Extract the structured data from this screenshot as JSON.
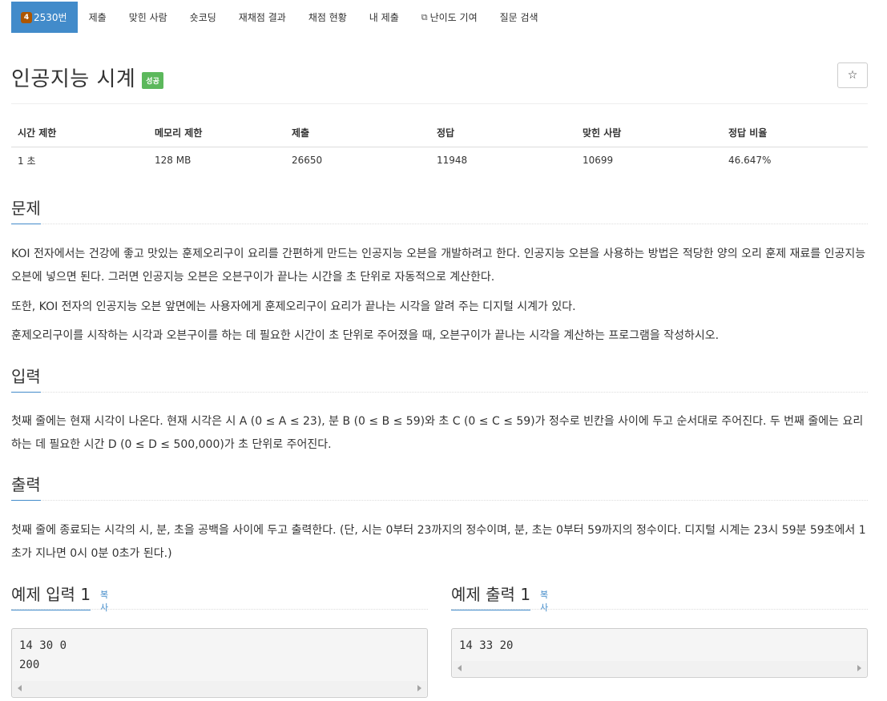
{
  "nav": {
    "problem_number_badge": "4",
    "problem_number": "2530번",
    "items": [
      "제출",
      "맞힌 사람",
      "숏코딩",
      "재채점 결과",
      "채점 현황",
      "내 제출",
      "난이도 기여",
      "질문 검색"
    ]
  },
  "problem": {
    "title": "인공지능 시계",
    "status_badge": "성공",
    "star_icon": "☆"
  },
  "stats": {
    "headers": [
      "시간 제한",
      "메모리 제한",
      "제출",
      "정답",
      "맞힌 사람",
      "정답 비율"
    ],
    "values": [
      "1 초",
      "128 MB",
      "26650",
      "11948",
      "10699",
      "46.647%"
    ]
  },
  "sections": {
    "problem_heading": "문제",
    "problem_p1": "KOI 전자에서는 건강에 좋고 맛있는 훈제오리구이 요리를 간편하게 만드는 인공지능 오븐을 개발하려고 한다. 인공지능 오븐을 사용하는 방법은 적당한 양의 오리 훈제 재료를 인공지능 오븐에 넣으면 된다. 그러면 인공지능 오븐은 오븐구이가 끝나는 시간을 초 단위로 자동적으로 계산한다.",
    "problem_p2": "또한, KOI 전자의 인공지능 오븐 앞면에는 사용자에게 훈제오리구이 요리가 끝나는 시각을 알려 주는 디지털 시계가 있다.",
    "problem_p3": "훈제오리구이를 시작하는 시각과 오븐구이를 하는 데 필요한 시간이 초 단위로 주어졌을 때, 오븐구이가 끝나는 시각을 계산하는 프로그램을 작성하시오.",
    "input_heading": "입력",
    "input_p": "첫째 줄에는 현재 시각이 나온다. 현재 시각은 시 A (0 ≤ A ≤ 23), 분 B (0 ≤ B ≤ 59)와 초 C (0 ≤ C ≤ 59)가 정수로 빈칸을 사이에 두고 순서대로 주어진다. 두 번째 줄에는 요리하는 데 필요한 시간 D (0 ≤ D ≤ 500,000)가 초 단위로 주어진다.",
    "output_heading": "출력",
    "output_p": "첫째 줄에 종료되는 시각의 시, 분, 초을 공백을 사이에 두고 출력한다. (단, 시는 0부터 23까지의 정수이며, 분, 초는 0부터 59까지의 정수이다. 디지털 시계는 23시 59분 59초에서 1초가 지나면 0시 0분 0초가 된다.)"
  },
  "samples": {
    "input_heading": "예제 입력 1",
    "output_heading": "예제 출력 1",
    "copy_label": "복사",
    "input_value": "14 30 0\n200",
    "output_value": "14 33 20"
  }
}
